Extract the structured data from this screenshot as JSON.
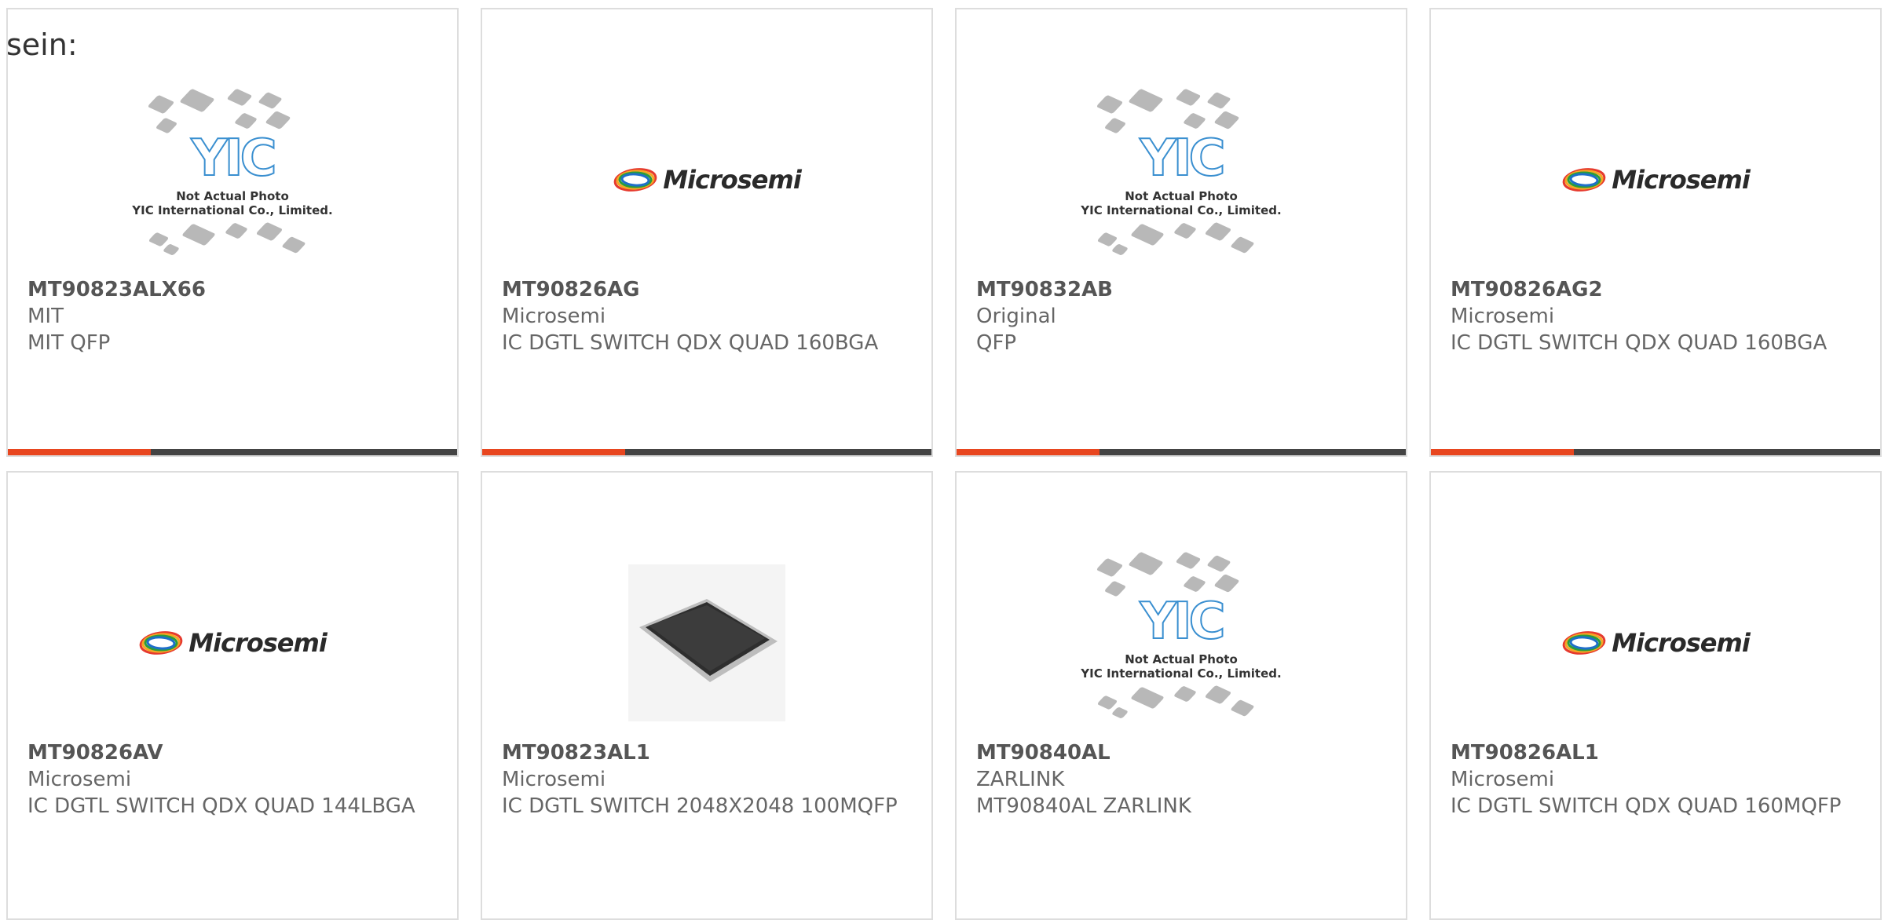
{
  "header": {
    "lead_text": "sein:"
  },
  "yic_caption": {
    "line1": "Not Actual Photo",
    "line2": "YIC International Co., Limited."
  },
  "microsemi_logo_text": "Microsemi",
  "colors": {
    "accent": "#e8461f",
    "bar": "#444444",
    "border": "#dddddd",
    "text": "#666666"
  },
  "products": [
    {
      "part": "MT90823ALX66",
      "manufacturer": "MIT",
      "description": "MIT QFP",
      "image": "yic-placeholder",
      "accent_bar": true
    },
    {
      "part": "MT90826AG",
      "manufacturer": "Microsemi",
      "description": "IC DGTL SWITCH QDX QUAD 160BGA",
      "image": "microsemi-logo",
      "accent_bar": true
    },
    {
      "part": "MT90832AB",
      "manufacturer": "Original",
      "description": "QFP",
      "image": "yic-placeholder",
      "accent_bar": true
    },
    {
      "part": "MT90826AG2",
      "manufacturer": "Microsemi",
      "description": "IC DGTL SWITCH QDX QUAD 160BGA",
      "image": "microsemi-logo",
      "accent_bar": true
    },
    {
      "part": "MT90826AV",
      "manufacturer": "Microsemi",
      "description": "IC DGTL SWITCH QDX QUAD 144LBGA",
      "image": "microsemi-logo",
      "accent_bar": false
    },
    {
      "part": "MT90823AL1",
      "manufacturer": "Microsemi",
      "description": "IC DGTL SWITCH 2048X2048 100MQFP",
      "image": "chip-photo",
      "accent_bar": false
    },
    {
      "part": "MT90840AL",
      "manufacturer": "ZARLINK",
      "description": "MT90840AL ZARLINK",
      "image": "yic-placeholder",
      "accent_bar": false
    },
    {
      "part": "MT90826AL1",
      "manufacturer": "Microsemi",
      "description": "IC DGTL SWITCH QDX QUAD 160MQFP",
      "image": "microsemi-logo",
      "accent_bar": false
    }
  ]
}
